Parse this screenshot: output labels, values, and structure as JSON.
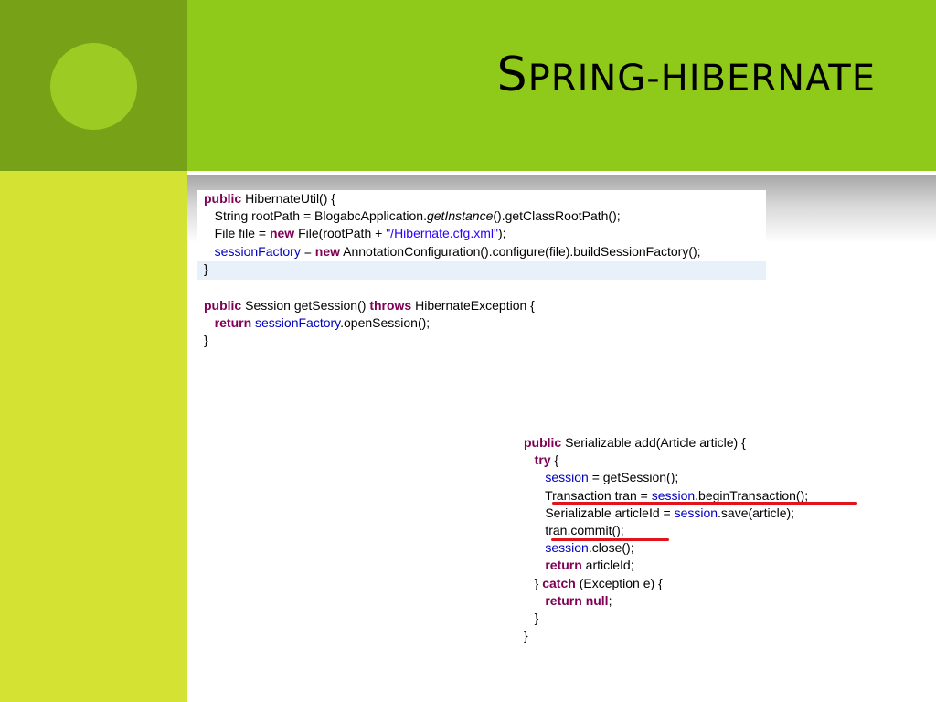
{
  "slide": {
    "title_initial": "S",
    "title_rest": "pring-hibernate",
    "colors": {
      "corner": "#77a217",
      "circle": "#9ccc24",
      "title_bar": "#8fc919",
      "side_bar": "#d4e234",
      "underline": "#e0141a"
    }
  },
  "code_block_1": [
    [
      {
        "t": "public",
        "c": "kw"
      },
      {
        "t": " HibernateUtil() {"
      }
    ],
    [
      {
        "t": "   String rootPath = BlogabcApplication."
      },
      {
        "t": "getInstance",
        "c": "it"
      },
      {
        "t": "().getClassRootPath();"
      }
    ],
    [
      {
        "t": "   File file = "
      },
      {
        "t": "new",
        "c": "kw"
      },
      {
        "t": " File(rootPath + "
      },
      {
        "t": "\"/Hibernate.cfg.xml\"",
        "c": "str"
      },
      {
        "t": ");"
      }
    ],
    [
      {
        "t": "   "
      },
      {
        "t": "sessionFactory",
        "c": "fld"
      },
      {
        "t": " = "
      },
      {
        "t": "new",
        "c": "kw"
      },
      {
        "t": " AnnotationConfiguration().configure(file).buildSessionFactory();"
      }
    ],
    [
      {
        "t": "}"
      }
    ]
  ],
  "code_block_2": [
    [
      {
        "t": "public",
        "c": "kw"
      },
      {
        "t": " Session getSession() "
      },
      {
        "t": "throws",
        "c": "kw"
      },
      {
        "t": " HibernateException {"
      }
    ],
    [
      {
        "t": "   "
      },
      {
        "t": "return",
        "c": "kw"
      },
      {
        "t": " "
      },
      {
        "t": "sessionFactory",
        "c": "fld"
      },
      {
        "t": ".openSession();"
      }
    ],
    [
      {
        "t": "}"
      }
    ]
  ],
  "code_block_3": [
    [
      {
        "t": "public",
        "c": "kw"
      },
      {
        "t": " Serializable add(Article article) {"
      }
    ],
    [
      {
        "t": "   "
      },
      {
        "t": "try",
        "c": "kw"
      },
      {
        "t": " {"
      }
    ],
    [
      {
        "t": "      "
      },
      {
        "t": "session",
        "c": "fld"
      },
      {
        "t": " = getSession();"
      }
    ],
    [
      {
        "t": "      Transaction tran = "
      },
      {
        "t": "session",
        "c": "fld"
      },
      {
        "t": ".beginTransaction();"
      }
    ],
    [
      {
        "t": "      Serializable articleId = "
      },
      {
        "t": "session",
        "c": "fld"
      },
      {
        "t": ".save(article);"
      }
    ],
    [
      {
        "t": "      tran.commit();"
      }
    ],
    [
      {
        "t": "      "
      },
      {
        "t": "session",
        "c": "fld"
      },
      {
        "t": ".close();"
      }
    ],
    [
      {
        "t": "      "
      },
      {
        "t": "return",
        "c": "kw"
      },
      {
        "t": " articleId;"
      }
    ],
    [
      {
        "t": "   } "
      },
      {
        "t": "catch",
        "c": "kw"
      },
      {
        "t": " (Exception e) {"
      }
    ],
    [
      {
        "t": "      "
      },
      {
        "t": "return",
        "c": "kw"
      },
      {
        "t": " "
      },
      {
        "t": "null",
        "c": "kw"
      },
      {
        "t": ";"
      }
    ],
    [
      {
        "t": "   }"
      }
    ],
    [
      {
        "t": "}"
      }
    ]
  ]
}
